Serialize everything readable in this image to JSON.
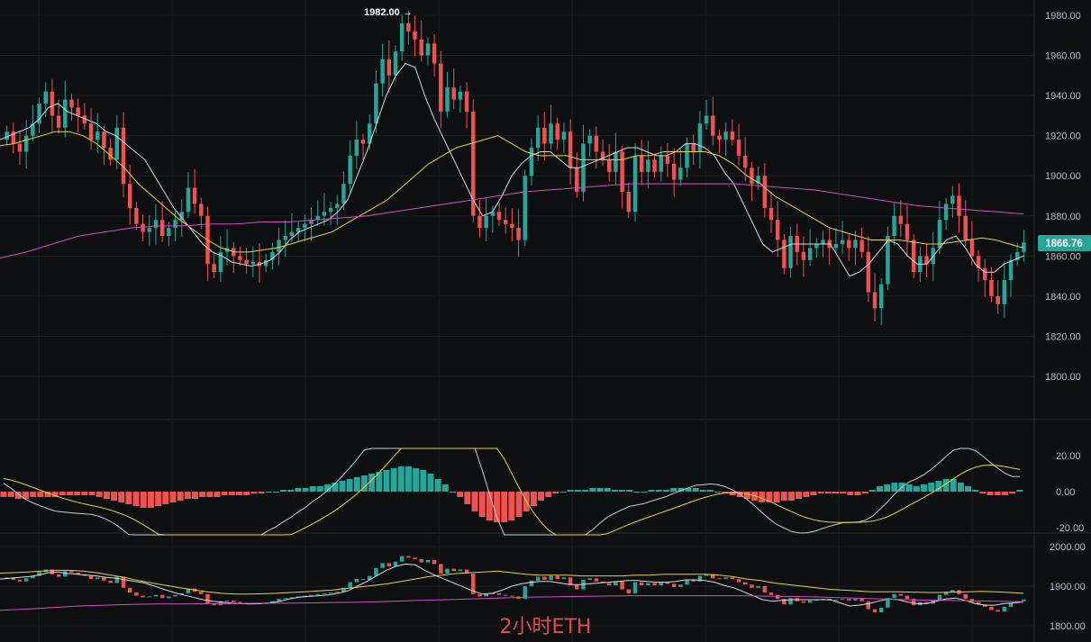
{
  "watermark": "2小时ETH",
  "colors": {
    "up": "#26a69a",
    "down": "#ef5350",
    "ma_short": "#d7dbe3",
    "ma_mid": "#e8d43a",
    "ma_long": "#d14fc4",
    "current_tag": "#26a69a"
  },
  "price_axis": {
    "ticks": [
      "1980.00",
      "1960.00",
      "1940.00",
      "1920.00",
      "1900.00",
      "1880.00",
      "1860.00",
      "1840.00",
      "1820.00",
      "1800.00"
    ]
  },
  "macd_axis": {
    "ticks": [
      "20.00",
      "0.00",
      "-20.00"
    ]
  },
  "bottom_axis": {
    "ticks": [
      "2000.00",
      "1900.00",
      "1800.00"
    ]
  },
  "current_price": "1866.76",
  "peak_label": "1982.00 →",
  "chart_data": [
    {
      "type": "candlestick",
      "panel": "price",
      "ylim": [
        1790,
        1985
      ],
      "grid": true,
      "close": [
        1922,
        1916,
        1912,
        1920,
        1926,
        1936,
        1942,
        1930,
        1924,
        1938,
        1934,
        1930,
        1926,
        1918,
        1922,
        1914,
        1908,
        1924,
        1896,
        1884,
        1876,
        1872,
        1874,
        1878,
        1870,
        1874,
        1878,
        1882,
        1894,
        1886,
        1880,
        1856,
        1852,
        1862,
        1864,
        1860,
        1858,
        1856,
        1857,
        1855,
        1858,
        1862,
        1868,
        1870,
        1872,
        1874,
        1876,
        1878,
        1880,
        1882,
        1884,
        1886,
        1896,
        1910,
        1918,
        1916,
        1926,
        1946,
        1958,
        1950,
        1962,
        1976,
        1972,
        1968,
        1960,
        1966,
        1956,
        1932,
        1944,
        1938,
        1942,
        1932,
        1880,
        1874,
        1880,
        1882,
        1878,
        1876,
        1874,
        1868,
        1900,
        1914,
        1924,
        1916,
        1926,
        1918,
        1922,
        1904,
        1892,
        1916,
        1920,
        1912,
        1908,
        1902,
        1912,
        1892,
        1882,
        1910,
        1902,
        1908,
        1902,
        1910,
        1906,
        1898,
        1904,
        1916,
        1912,
        1926,
        1930,
        1920,
        1918,
        1922,
        1918,
        1910,
        1904,
        1896,
        1900,
        1884,
        1878,
        1868,
        1854,
        1870,
        1862,
        1858,
        1864,
        1866,
        1868,
        1864,
        1866,
        1868,
        1864,
        1868,
        1862,
        1842,
        1834,
        1846,
        1870,
        1880,
        1876,
        1868,
        1852,
        1860,
        1856,
        1864,
        1878,
        1886,
        1890,
        1880,
        1868,
        1860,
        1854,
        1848,
        1840,
        1836,
        1848,
        1858,
        1862,
        1866.76
      ],
      "series": [
        {
          "name": "",
          "kind": "ma",
          "values": [
            1918,
            1920,
            1922,
            1924,
            1928,
            1934,
            1936,
            1932,
            1930,
            1928,
            1926,
            1922,
            1920,
            1916,
            1912,
            1908,
            1900,
            1892,
            1884,
            1878,
            1872,
            1866,
            1862,
            1860,
            1857,
            1856,
            1855,
            1856,
            1858,
            1862,
            1868,
            1872,
            1874,
            1876,
            1878,
            1882,
            1888,
            1900,
            1912,
            1926,
            1940,
            1950,
            1956,
            1954,
            1940,
            1928,
            1918,
            1908,
            1898,
            1888,
            1880,
            1882,
            1890,
            1900,
            1906,
            1910,
            1912,
            1912,
            1908,
            1904,
            1904,
            1906,
            1908,
            1910,
            1912,
            1914,
            1914,
            1912,
            1910,
            1910,
            1912,
            1916,
            1916,
            1914,
            1910,
            1902,
            1896,
            1886,
            1876,
            1866,
            1862,
            1864,
            1866,
            1866,
            1866,
            1866,
            1866,
            1858,
            1850,
            1852,
            1856,
            1862,
            1868,
            1866,
            1860,
            1856,
            1856,
            1862,
            1868,
            1870,
            1864,
            1856,
            1852,
            1852,
            1856,
            1858,
            1860
          ]
        },
        {
          "name": "",
          "kind": "ma",
          "values": [
            1915,
            1916,
            1918,
            1920,
            1922,
            1922,
            1920,
            1916,
            1910,
            1904,
            1896,
            1890,
            1884,
            1878,
            1873,
            1868,
            1864,
            1862,
            1862,
            1863,
            1864,
            1866,
            1868,
            1870,
            1872,
            1876,
            1880,
            1884,
            1888,
            1894,
            1900,
            1906,
            1910,
            1914,
            1916,
            1918,
            1920,
            1916,
            1912,
            1910,
            1910,
            1910,
            1908,
            1908,
            1908,
            1908,
            1910,
            1910,
            1912,
            1912,
            1912,
            1912,
            1910,
            1906,
            1900,
            1896,
            1890,
            1886,
            1882,
            1878,
            1874,
            1872,
            1870,
            1868,
            1868,
            1868,
            1867,
            1866,
            1866,
            1867,
            1868,
            1869,
            1868,
            1866,
            1864
          ]
        },
        {
          "name": "",
          "kind": "ma",
          "values": [
            1859,
            1862,
            1866,
            1870,
            1872,
            1874,
            1875,
            1875,
            1876,
            1876,
            1877,
            1877,
            1878,
            1879,
            1880,
            1882,
            1884,
            1886,
            1888,
            1890,
            1892,
            1893,
            1894,
            1895,
            1896,
            1896,
            1896,
            1896,
            1896,
            1895,
            1894,
            1893,
            1891,
            1889,
            1887,
            1885,
            1884,
            1883,
            1882,
            1881
          ]
        }
      ]
    },
    {
      "type": "macd",
      "panel": "macd",
      "ylim": [
        -25,
        25
      ],
      "ticks": [
        20,
        0,
        -20
      ],
      "histogram": [
        -3,
        -3,
        -4,
        -4,
        -3,
        -3,
        -3,
        -3,
        -2,
        -2,
        -2,
        -2,
        -2,
        -3,
        -4,
        -5,
        -6,
        -7,
        -8,
        -9,
        -9,
        -8,
        -7,
        -6,
        -5,
        -4,
        -4,
        -3,
        -3,
        -3,
        -2,
        -2,
        -2,
        -2,
        -1,
        -1,
        0,
        0,
        1,
        1,
        2,
        2,
        3,
        3,
        4,
        5,
        6,
        7,
        8,
        9,
        10,
        11,
        12,
        13,
        14,
        14,
        13,
        12,
        10,
        7,
        4,
        0,
        -3,
        -7,
        -11,
        -14,
        -16,
        -17,
        -17,
        -16,
        -14,
        -11,
        -8,
        -5,
        -3,
        -1,
        0,
        1,
        1,
        1,
        2,
        2,
        2,
        1,
        1,
        1,
        0,
        0,
        1,
        1,
        1,
        2,
        2,
        2,
        2,
        1,
        1,
        0,
        -1,
        -2,
        -3,
        -4,
        -5,
        -6,
        -6,
        -6,
        -5,
        -5,
        -4,
        -3,
        -2,
        -1,
        -1,
        -1,
        -1,
        -2,
        -2,
        -1,
        1,
        3,
        4,
        5,
        5,
        4,
        3,
        4,
        5,
        6,
        7,
        7,
        5,
        3,
        1,
        -1,
        -2,
        -2,
        -2,
        -1,
        1
      ]
    },
    {
      "type": "candlestick",
      "panel": "bottom",
      "ylim": [
        1790,
        2010
      ],
      "ticks": [
        2000,
        1900,
        1800
      ]
    }
  ]
}
